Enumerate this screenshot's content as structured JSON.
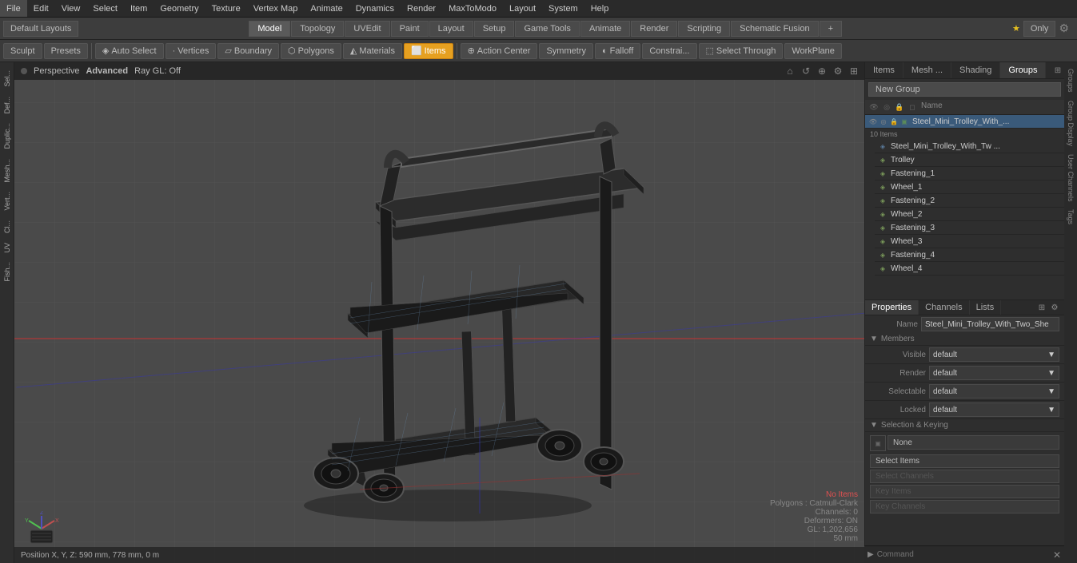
{
  "menuBar": {
    "items": [
      "File",
      "Edit",
      "View",
      "Select",
      "Item",
      "Geometry",
      "Texture",
      "Vertex Map",
      "Animate",
      "Dynamics",
      "Render",
      "MaxToModo",
      "Layout",
      "System",
      "Help"
    ]
  },
  "layoutTabs": {
    "tabs": [
      "Model",
      "Topology",
      "UVEdit",
      "Paint",
      "Layout",
      "Setup",
      "Game Tools",
      "Animate",
      "Render",
      "Scripting",
      "Schematic Fusion"
    ],
    "active": "Model",
    "rightLabel": "Only",
    "defaultLayout": "Default Layouts"
  },
  "toolbar2": {
    "sculpt": "Sculpt",
    "presets": "Presets",
    "autoSelect": "Auto Select",
    "vertices": "Vertices",
    "boundary": "Boundary",
    "polygons": "Polygons",
    "materials": "Materials",
    "items": "Items",
    "actionCenter": "Action Center",
    "symmetry": "Symmetry",
    "falloff": "Falloff",
    "constraints": "Constrai...",
    "selectThrough": "Select Through",
    "workplane": "WorkPlane"
  },
  "viewport": {
    "label": "Perspective",
    "advanced": "Advanced",
    "rayGL": "Ray GL: Off",
    "statusBar": "Position X, Y, Z:  590 mm, 778 mm, 0 m"
  },
  "viewportInfo": {
    "noItems": "No Items",
    "polygons": "Polygons : Catmull-Clark",
    "channels": "Channels: 0",
    "deformers": "Deformers: ON",
    "gl": "GL: 1,202,656",
    "mm": "50 mm"
  },
  "rightPanel": {
    "tabs": [
      "Items",
      "Mesh ...",
      "Shading",
      "Groups"
    ],
    "activeTab": "Groups",
    "newGroupBtn": "New Group",
    "nameHeader": "Name",
    "groupName": "Steel_Mini_Trolley_With_...",
    "itemCount": "10 Items",
    "items": [
      {
        "name": "Steel_Mini_Trolley_With_Tw ...",
        "indent": false,
        "selected": false
      },
      {
        "name": "Trolley",
        "indent": true,
        "selected": false
      },
      {
        "name": "Fastening_1",
        "indent": true,
        "selected": false
      },
      {
        "name": "Wheel_1",
        "indent": true,
        "selected": false
      },
      {
        "name": "Fastening_2",
        "indent": true,
        "selected": false
      },
      {
        "name": "Wheel_2",
        "indent": true,
        "selected": false
      },
      {
        "name": "Fastening_3",
        "indent": true,
        "selected": false
      },
      {
        "name": "Wheel_3",
        "indent": true,
        "selected": false
      },
      {
        "name": "Fastening_4",
        "indent": true,
        "selected": false
      },
      {
        "name": "Wheel_4",
        "indent": true,
        "selected": false
      }
    ]
  },
  "properties": {
    "tabs": [
      "Properties",
      "Channels",
      "Lists"
    ],
    "activeTab": "Properties",
    "nameLabel": "Name",
    "nameValue": "Steel_Mini_Trolley_With_Two_She",
    "membersSection": "Members",
    "visibleLabel": "Visible",
    "visibleValue": "default",
    "renderLabel": "Render",
    "renderValue": "default",
    "selectableLabel": "Selectable",
    "selectableValue": "default",
    "lockedLabel": "Locked",
    "lockedValue": "default",
    "selectionKeying": "Selection & Keying",
    "noneLabel": "None",
    "selectItemsBtn": "Select Items",
    "selectChannelsBtn": "Select Channels",
    "keyItemsBtn": "Key Items",
    "keyChannelsBtn": "Key Channels"
  },
  "leftSidebar": {
    "tabs": [
      "Sel...",
      "Def...",
      "Duplic...",
      "Mesh...",
      "Vert...",
      "Cl...",
      "UV",
      "Fish..."
    ]
  },
  "rightSidebarTabs": [
    "Groups",
    "Group Display",
    "User Channels",
    "Tags"
  ],
  "commandBar": {
    "placeholder": "Command"
  }
}
